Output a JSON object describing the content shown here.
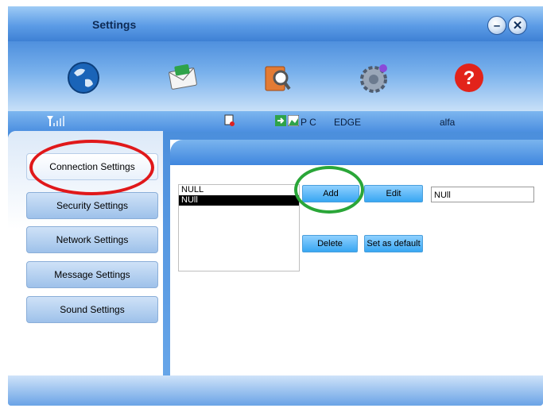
{
  "window": {
    "title": "Settings"
  },
  "title_buttons": {
    "minimize_icon": "minimize-icon",
    "close_icon": "close-icon"
  },
  "toolbar": {
    "items": [
      {
        "icon": "globe-icon"
      },
      {
        "icon": "envelope-icon"
      },
      {
        "icon": "contacts-search-icon"
      },
      {
        "icon": "gear-icon"
      },
      {
        "icon": "help-icon"
      }
    ]
  },
  "status": {
    "signal_icon": "signal-strength-icon",
    "pc_label": "P C",
    "network": "EDGE",
    "operator": "alfa"
  },
  "sidebar": {
    "items": [
      {
        "label": "Connection Settings"
      },
      {
        "label": "Security Settings"
      },
      {
        "label": "Network Settings"
      },
      {
        "label": "Message Settings"
      },
      {
        "label": "Sound Settings"
      }
    ]
  },
  "profiles": {
    "items": [
      "NULL",
      "NUll"
    ],
    "selected_index": 1,
    "add_label": "Add",
    "edit_label": "Edit",
    "delete_label": "Delete",
    "default_label": "Set as default",
    "name_value": "NUll"
  },
  "colors": {
    "accent": "#3f86de",
    "button": "#38a7f2",
    "annotation_red": "#e0181a",
    "annotation_green": "#2aa638"
  }
}
